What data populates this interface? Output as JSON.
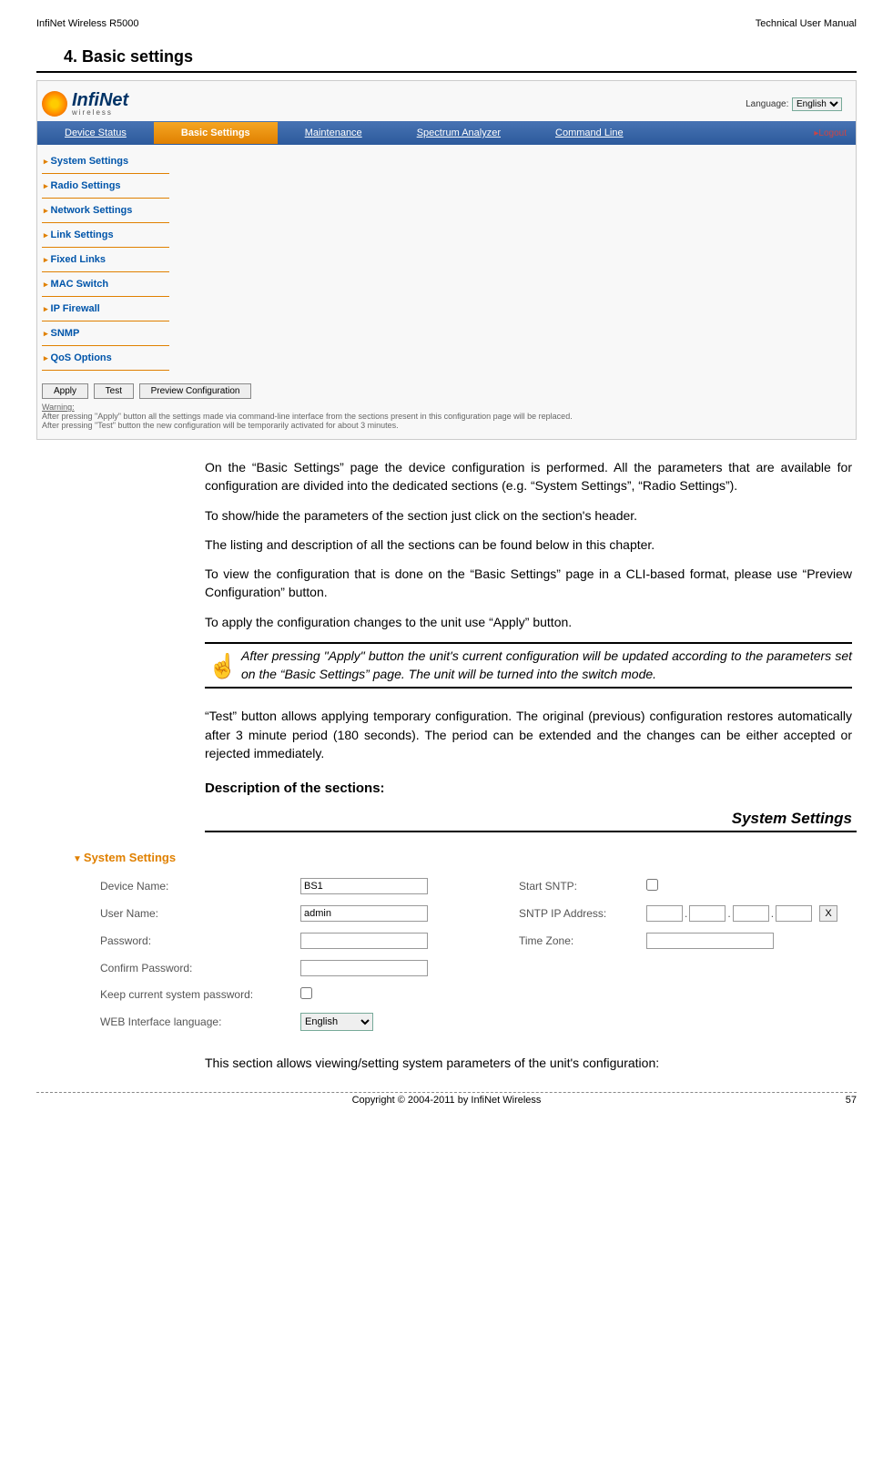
{
  "header": {
    "left": "InfiNet Wireless R5000",
    "right": "Technical User Manual"
  },
  "title": "4. Basic settings",
  "screenshot1": {
    "logo": "InfiNet",
    "logo_sub": "wireless",
    "lang_label": "Language:",
    "lang_value": "English",
    "nav": [
      "Device Status",
      "Basic Settings",
      "Maintenance",
      "Spectrum Analyzer",
      "Command Line"
    ],
    "logout": "▸Logout",
    "sidebar": [
      "System Settings",
      "Radio Settings",
      "Network Settings",
      "Link Settings",
      "Fixed Links",
      "MAC Switch",
      "IP Firewall",
      "SNMP",
      "QoS Options"
    ],
    "buttons": [
      "Apply",
      "Test",
      "Preview Configuration"
    ],
    "warning_title": "Warning:",
    "warning_l1": "After pressing \"Apply\" button all the settings made via command-line interface from the sections present in this configuration page will be replaced.",
    "warning_l2": "After pressing \"Test\" button the new configuration will be temporarily activated for about 3 minutes."
  },
  "body": {
    "p1": "On the “Basic Settings” page the device configuration is performed. All the parameters that are available for configuration are divided into the dedicated sections (e.g. “System Settings”, “Radio Settings”).",
    "p2": "To show/hide the parameters of the section just click on the section's header.",
    "p3": "The listing and description of all the sections can be found below in this chapter.",
    "p4": "To view the configuration that is done on the “Basic Settings” page in a CLI-based format, please use “Preview Configuration” button.",
    "p5": "To apply the configuration changes to the unit use “Apply” button.",
    "note": "After pressing \"Apply\" button the unit's current configuration will be updated according to the parameters set on the “Basic Settings” page. The unit will be turned into the switch mode.",
    "p6": "“Test” button allows applying temporary configuration. The original (previous) configuration restores automatically after 3 minute period (180 seconds). The period can be extended and the changes can be either accepted or rejected immediately.",
    "desc_title": "Description of the sections:",
    "sys_title": "System Settings"
  },
  "sys_form": {
    "header": "System Settings",
    "device_name_lbl": "Device Name:",
    "device_name_val": "BS1",
    "user_name_lbl": "User Name:",
    "user_name_val": "admin",
    "password_lbl": "Password:",
    "confirm_lbl": "Confirm Password:",
    "keep_lbl": "Keep current system password:",
    "web_lang_lbl": "WEB Interface language:",
    "web_lang_val": "English",
    "sntp_lbl": "Start SNTP:",
    "sntp_ip_lbl": "SNTP IP Address:",
    "tz_lbl": "Time Zone:",
    "x_btn": "X"
  },
  "body2": {
    "p7": "This section allows viewing/setting system parameters of the unit's configuration:"
  },
  "footer": {
    "copyright": "Copyright © 2004-2011 by InfiNet Wireless",
    "page": "57"
  }
}
